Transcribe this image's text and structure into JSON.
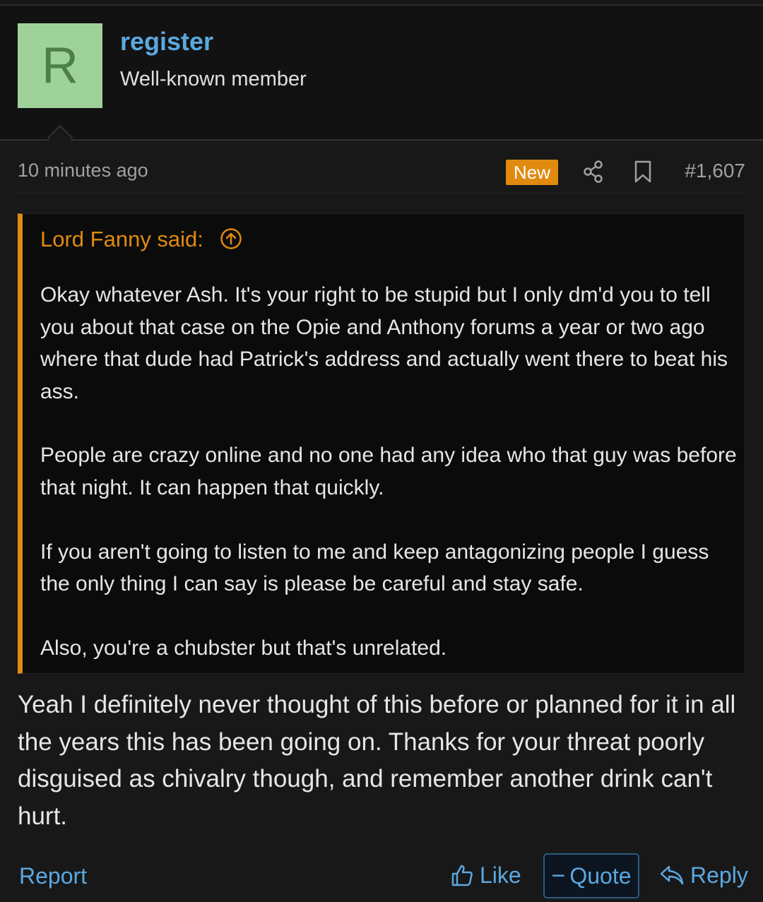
{
  "user": {
    "avatar_letter": "R",
    "username": "register",
    "title": "Well-known member"
  },
  "post": {
    "time": "10 minutes ago",
    "badge": "New",
    "number": "#1,607",
    "icons": [
      "share-icon",
      "bookmark-icon"
    ]
  },
  "quote": {
    "author_line": "Lord Fanny said:",
    "paragraphs": [
      "Okay whatever Ash. It's your right to be stupid but I only dm'd you to tell you about that case on the Opie and Anthony forums a year or two ago where that dude had Patrick's address and actually went there to beat his ass.",
      "People are crazy online and no one had any idea who that guy was before that night. It can happen that quickly.",
      "If you aren't going to listen to me and keep antagonizing people I guess the only thing I can say is please be careful and stay safe.",
      "Also, you're a chubster but that's unrelated."
    ]
  },
  "message": "Yeah I definitely never thought of this before or planned for it in all the years this has been going on. Thanks for your threat poorly disguised as chivalry though, and remember another drink can't hurt.",
  "actions": {
    "report": "Report",
    "like": "Like",
    "quote": "Quote",
    "reply": "Reply"
  },
  "colors": {
    "accent": "#e08a10",
    "link": "#5aa8e0",
    "avatar_bg": "#9ed29a"
  }
}
